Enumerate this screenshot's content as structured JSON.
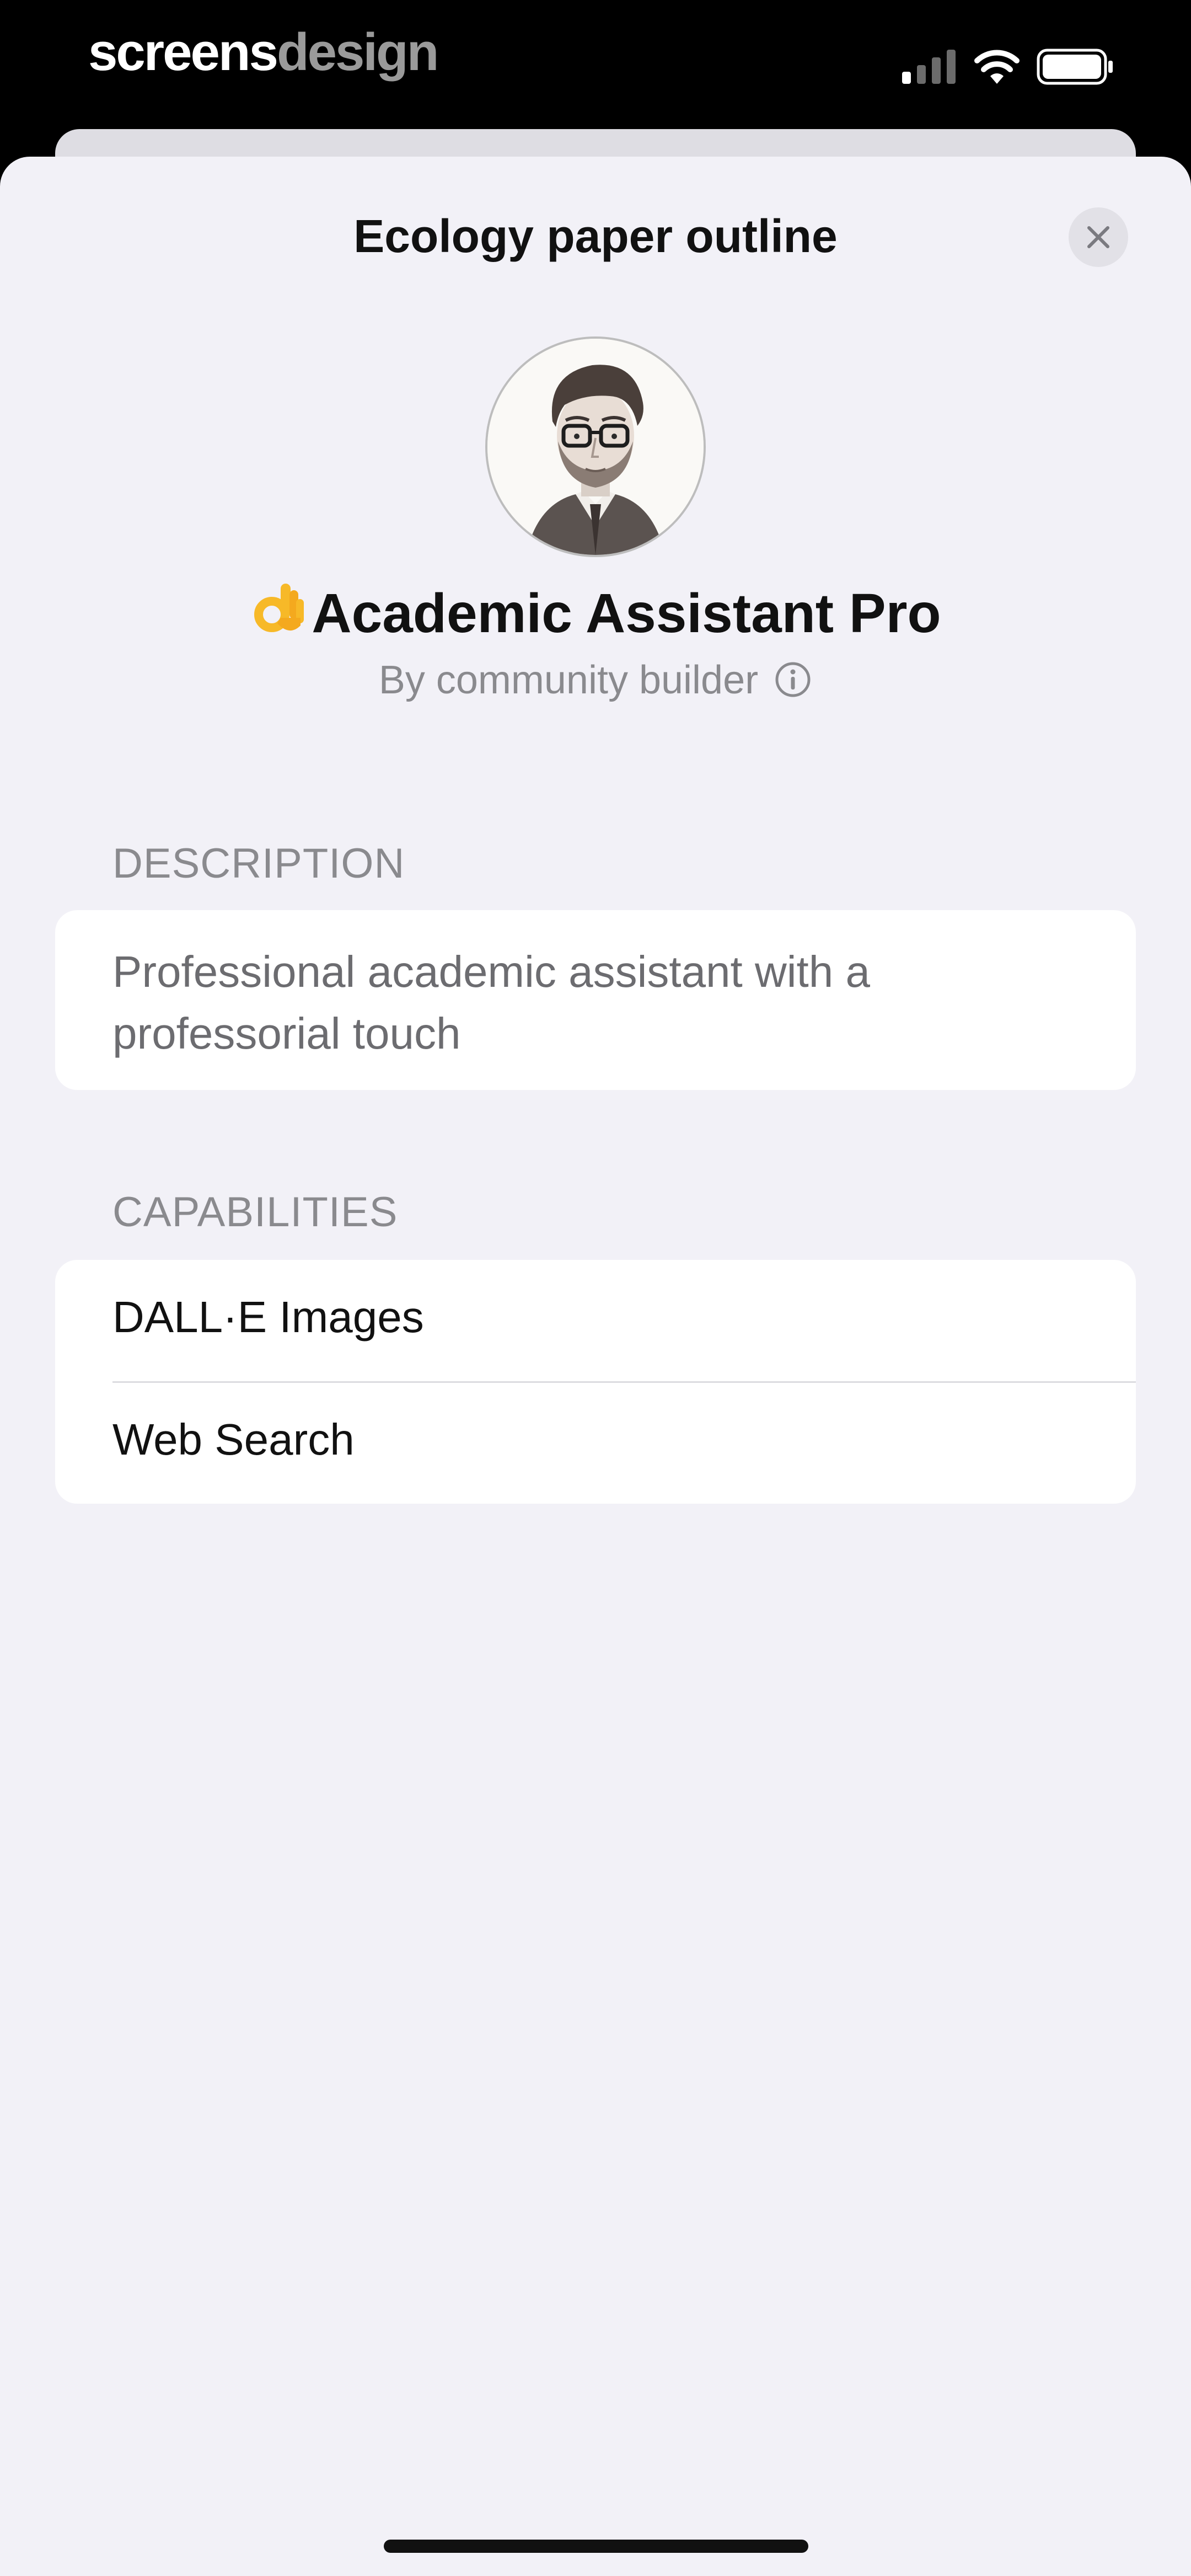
{
  "status_bar": {
    "brand_primary": "screens",
    "brand_secondary": "design",
    "signal_icon": "cellular-signal-icon",
    "wifi_icon": "wifi-icon",
    "battery_icon": "battery-icon"
  },
  "header": {
    "title": "Ecology paper outline",
    "close_icon": "close-icon"
  },
  "gpt": {
    "emoji": "👌",
    "name": "Academic Assistant Pro",
    "author": "By community builder",
    "info_icon": "info-icon"
  },
  "description": {
    "label": "DESCRIPTION",
    "text": "Professional academic assistant with a professorial touch"
  },
  "capabilities": {
    "label": "CAPABILITIES",
    "items": [
      {
        "label": "DALL·E Images"
      },
      {
        "label": "Web Search"
      }
    ]
  },
  "colors": {
    "sheet_background": "#f2f1f7",
    "card_background": "#ffffff",
    "secondary_text": "#8a8a8e",
    "primary_text": "#111111"
  }
}
